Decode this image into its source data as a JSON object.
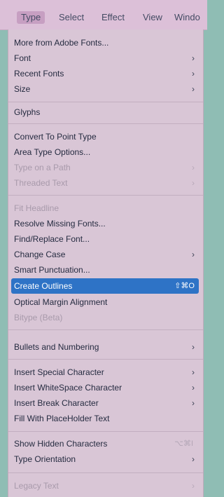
{
  "menubar": {
    "items": [
      "Type",
      "Select",
      "Effect",
      "View",
      "Windo"
    ]
  },
  "menu": {
    "items": [
      {
        "label": "More from Adobe Fonts..."
      },
      {
        "label": "Font",
        "submenu": true
      },
      {
        "label": "Recent Fonts",
        "submenu": true
      },
      {
        "label": "Size",
        "submenu": true
      },
      {
        "label": "Glyphs"
      },
      {
        "label": "Convert To Point Type"
      },
      {
        "label": "Area Type Options..."
      },
      {
        "label": "Type on a Path",
        "submenu": true,
        "disabled": true
      },
      {
        "label": "Threaded Text",
        "submenu": true,
        "disabled": true
      },
      {
        "label": "Fit Headline",
        "disabled": true
      },
      {
        "label": "Resolve Missing Fonts..."
      },
      {
        "label": "Find/Replace Font..."
      },
      {
        "label": "Change Case",
        "submenu": true
      },
      {
        "label": "Smart Punctuation..."
      },
      {
        "label": "Create Outlines",
        "shortcut": "⇧⌘O",
        "selected": true
      },
      {
        "label": "Optical Margin Alignment"
      },
      {
        "label": "Bitype (Beta)",
        "disabled": true
      },
      {
        "label": "Bullets and Numbering",
        "submenu": true
      },
      {
        "label": "Insert Special Character",
        "submenu": true
      },
      {
        "label": "Insert WhiteSpace Character",
        "submenu": true
      },
      {
        "label": "Insert Break Character",
        "submenu": true
      },
      {
        "label": "Fill With PlaceHolder Text"
      },
      {
        "label": "Show Hidden Characters",
        "shortcut": "⌥⌘I",
        "shortcut_disabled": true
      },
      {
        "label": "Type Orientation",
        "submenu": true
      },
      {
        "label": "Legacy Text",
        "submenu": true,
        "disabled": true
      }
    ],
    "arrow_glyph": "›"
  },
  "colors": {
    "menubar_bg": "#dcc0d8",
    "menu_bg": "#d9c6d6",
    "selected_bg": "#2e73c6",
    "canvas_bg": "#8fbdb4"
  }
}
